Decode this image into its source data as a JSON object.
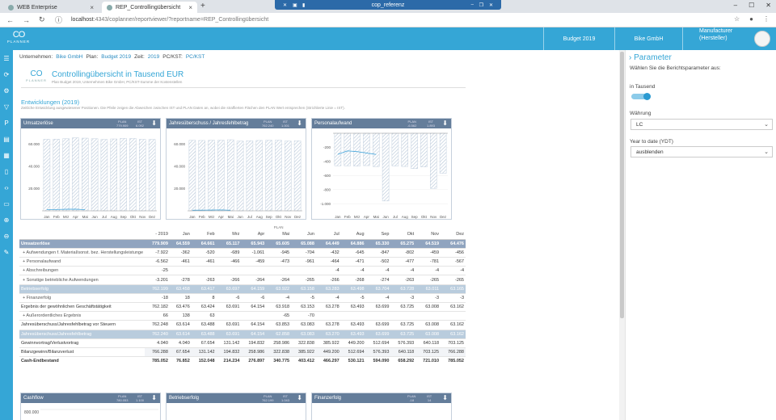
{
  "browser": {
    "tabs": [
      {
        "label": "WEB Enterprise"
      },
      {
        "label": "REP_Controllingübersicht"
      }
    ],
    "remote_title": "cop_referenz",
    "url_host": "localhost",
    "url_path": ":4343/coplanner/reportviewer/?reportname=REP_Controllingübersicht"
  },
  "header": {
    "logo_mark": "CO",
    "logo_word": "PLANNER",
    "budget": "Budget 2019",
    "company": "Bike GmbH",
    "role_line1": "Manufacturer",
    "role_line2": "(Hersteller)"
  },
  "params": {
    "company_label": "Unternehmen:",
    "company_value": "Bike GmbH",
    "plan_label": "Plan:",
    "plan_value": "Budget 2019",
    "time_label": "Zeit:",
    "time_value": "2019",
    "pc_label": "PC/KST:",
    "pc_value": "PC/KST"
  },
  "report": {
    "title": "Controllingübersicht in Tausend EUR",
    "subtitle": "Plan Budget 2019, Unternehmen Bike GmbH, PC/KST-Summe der Kostenstellen",
    "section_title": "Entwicklungen (2019)",
    "section_sub": "Zeitliche Entwicklung ausgewiesener Positionen. Die Pfeile zeigen die Abweichen zwischen IST und PLAN Daten an, wobei die straffierten Flächen den PLAN Wert entsprechen (Strichlierte Linie = IST)."
  },
  "chart_data": [
    {
      "type": "bar",
      "title": "Umsatzerlöse",
      "plan_label": "PLAN",
      "plan_value": "779.909",
      "ist_label": "IST",
      "ist_value": "6.092",
      "categories": [
        "Jan",
        "Feb",
        "Mrz",
        "Apr",
        "Mai",
        "Jun",
        "Jul",
        "Aug",
        "Sep",
        "Okt",
        "Nov",
        "Dez"
      ],
      "series": [
        {
          "name": "PLAN",
          "values": [
            64559,
            64661,
            65117,
            65943,
            65605,
            65088,
            64449,
            64886,
            65330,
            65275,
            64519,
            64476
          ]
        },
        {
          "name": "IST",
          "values": [
            1000,
            1200,
            1400,
            1500,
            1000,
            0,
            0,
            0,
            0,
            0,
            0,
            0
          ]
        }
      ],
      "yticks": [
        "",
        "20.000",
        "40.000",
        "60.000"
      ],
      "ylim": [
        0,
        70000
      ]
    },
    {
      "type": "bar",
      "title": "Jahresüberschuss / Jahresfehlbetrag",
      "plan_label": "PLAN",
      "plan_value": "762.240",
      "ist_label": "IST",
      "ist_value": "1.001",
      "categories": [
        "Jan",
        "Feb",
        "Mrz",
        "Apr",
        "Mai",
        "Jun",
        "Jul",
        "Aug",
        "Sep",
        "Okt",
        "Nov",
        "Dez"
      ],
      "series": [
        {
          "name": "PLAN",
          "values": [
            63614,
            63488,
            63691,
            63691,
            64154,
            62858,
            63270,
            63493,
            63699,
            63725,
            63008,
            63162
          ]
        },
        {
          "name": "IST",
          "values": [
            500,
            600,
            700,
            800,
            500,
            0,
            0,
            0,
            0,
            0,
            0,
            0
          ]
        }
      ],
      "yticks": [
        "",
        "20.000",
        "40.000",
        "60.000"
      ],
      "ylim": [
        0,
        70000
      ]
    },
    {
      "type": "bar",
      "title": "Personalaufwand",
      "plan_label": "PLAN",
      "plan_value": "-6.562",
      "ist_label": "IST",
      "ist_value": "1.893",
      "categories": [
        "Jan",
        "Feb",
        "Mrz",
        "Apr",
        "Mai",
        "Jun",
        "Jul",
        "Aug",
        "Sep",
        "Okt",
        "Nov",
        "Dez"
      ],
      "series": [
        {
          "name": "PLAN",
          "values": [
            -461,
            -461,
            -466,
            -459,
            -473,
            -961,
            -464,
            -471,
            -502,
            -477,
            -781,
            -567
          ]
        },
        {
          "name": "IST",
          "values": [
            -300,
            -250,
            -260,
            -280,
            -300,
            0,
            0,
            0,
            0,
            0,
            0,
            0
          ]
        }
      ],
      "yticks": [
        "-1.000",
        "-800",
        "-600",
        "-400",
        "-200",
        ""
      ],
      "ylim": [
        -1100,
        0
      ]
    }
  ],
  "table": {
    "plan_header": "PLAN",
    "columns": [
      "- 2019",
      "Jan",
      "Feb",
      "Mrz",
      "Apr",
      "Mai",
      "Jun",
      "Jul",
      "Aug",
      "Sep",
      "Okt",
      "Nov",
      "Dez"
    ],
    "rows": [
      {
        "style": "dark",
        "label": "Umsatzerlöse",
        "values": [
          "779.909",
          "64.559",
          "64.661",
          "65.117",
          "65.943",
          "65.605",
          "65.088",
          "64.449",
          "64.886",
          "65.330",
          "65.275",
          "64.519",
          "64.476"
        ]
      },
      {
        "style": "sub",
        "label": "+ Aufwendungen f. Material/sonst. bez. Herstellungsleistunge",
        "values": [
          "-7.922",
          "-362",
          "-520",
          "-689",
          "-1.061",
          "-945",
          "-704",
          "-432",
          "-645",
          "-847",
          "-802",
          "-459",
          "-456"
        ]
      },
      {
        "style": "sub",
        "label": "+ Personalaufwand",
        "values": [
          "-6.562",
          "-461",
          "-461",
          "-466",
          "-459",
          "-473",
          "-961",
          "-464",
          "-471",
          "-502",
          "-477",
          "-781",
          "-567"
        ]
      },
      {
        "style": "sub",
        "label": "+ Abschreibungen",
        "values": [
          "-25",
          "",
          "",
          "",
          "",
          "",
          "",
          "-4",
          "-4",
          "-4",
          "-4",
          "-4",
          "-4"
        ]
      },
      {
        "style": "sub",
        "label": "+ Sonstige betriebliche Aufwendungen",
        "values": [
          "-3.201",
          "-278",
          "-263",
          "-266",
          "-264",
          "-264",
          "-265",
          "-266",
          "-268",
          "-274",
          "-263",
          "-265",
          "-265"
        ]
      },
      {
        "style": "light",
        "label": "Betriebserfolg",
        "values": [
          "762.199",
          "63.458",
          "63.417",
          "63.697",
          "64.159",
          "63.922",
          "63.158",
          "63.283",
          "63.498",
          "63.704",
          "63.728",
          "63.011",
          "63.165"
        ]
      },
      {
        "style": "sub",
        "label": "+ Finanzerfolg",
        "values": [
          "-18",
          "18",
          "8",
          "-6",
          "-6",
          "-4",
          "-5",
          "-4",
          "-5",
          "-4",
          "-3",
          "-3",
          "-3"
        ]
      },
      {
        "style": "plain",
        "label": "Ergebnis der gewöhnlichen Geschäftstätigkeit",
        "values": [
          "762.182",
          "63.476",
          "63.424",
          "63.691",
          "64.154",
          "63.918",
          "63.153",
          "63.278",
          "63.493",
          "63.699",
          "63.725",
          "63.008",
          "63.162"
        ]
      },
      {
        "style": "sub",
        "label": "+ Außerordentliches Ergebnis",
        "values": [
          "66",
          "138",
          "63",
          "",
          "",
          "-65",
          "-70",
          "",
          "",
          "",
          "",
          "",
          ""
        ]
      },
      {
        "style": "plain",
        "label": "Jahresüberschuss/Jahresfehlbetrag vor Steuern",
        "values": [
          "762.248",
          "63.614",
          "63.488",
          "63.691",
          "64.154",
          "63.853",
          "63.083",
          "63.278",
          "63.493",
          "63.699",
          "63.725",
          "63.008",
          "63.162"
        ]
      },
      {
        "style": "light",
        "label": "Jahresüberschuss/Jahresfehlbetrag",
        "values": [
          "762.240",
          "63.614",
          "63.488",
          "63.691",
          "64.154",
          "62.858",
          "63.083",
          "63.270",
          "63.493",
          "63.699",
          "63.725",
          "63.008",
          "63.162"
        ]
      },
      {
        "style": "plain",
        "label": "Gewinnvortrag/Verlustvortrag",
        "values": [
          "4.040",
          "4.040",
          "67.654",
          "131.142",
          "194.832",
          "258.986",
          "322.838",
          "385.922",
          "449.200",
          "512.694",
          "576.393",
          "640.118",
          "703.125"
        ]
      },
      {
        "style": "grey",
        "label": "Bilanzgewinn/Bilanzverlust",
        "values": [
          "766.288",
          "67.654",
          "131.142",
          "194.832",
          "258.986",
          "322.838",
          "385.922",
          "449.200",
          "512.694",
          "576.393",
          "640.118",
          "703.125",
          "766.288"
        ]
      },
      {
        "style": "total",
        "label": "Cash-Endbestand",
        "values": [
          "785.052",
          "76.852",
          "152.048",
          "214.234",
          "276.897",
          "340.775",
          "403.412",
          "466.297",
          "530.121",
          "594.090",
          "658.292",
          "721.010",
          "785.052"
        ]
      }
    ]
  },
  "small_charts": [
    {
      "title": "Cashflow",
      "plan_label": "PLAN",
      "plan_value": "780.053",
      "ist_label": "IST",
      "ist_value": "1.100",
      "ytick": "800.000"
    },
    {
      "title": "Betriebserfolg",
      "plan_label": "PLAN",
      "plan_value": "762.199",
      "ist_label": "IST",
      "ist_value": "1.043",
      "ytick": ""
    },
    {
      "title": "Finanzerfolg",
      "plan_label": "PLAN",
      "plan_value": "-18",
      "ist_label": "IST",
      "ist_value": "14",
      "ytick": ""
    }
  ],
  "panel": {
    "title": "Parameter",
    "desc": "Wählen Sie die Berichtsparameter aus:",
    "thousand_label": "in Tausend",
    "currency_label": "Währung",
    "currency_value": "LC",
    "ytd_label": "Year to date (YDT)",
    "ytd_value": "ausblenden"
  },
  "colors": {
    "accent": "#35a6d6",
    "chart_header": "#647d9a",
    "row_dark": "#90a4bf",
    "row_light": "#b9ccdd"
  }
}
